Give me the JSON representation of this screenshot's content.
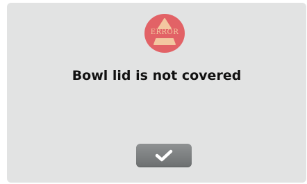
{
  "dialog": {
    "badge": {
      "icon": "error-warning-icon",
      "text": "ERROR",
      "color": "#e26266",
      "text_color": "#f3c7a0"
    },
    "message": "Bowl lid is not covered",
    "confirm_button": {
      "icon": "checkmark-icon",
      "color": "#7e8182"
    },
    "background": "#e2e3e3"
  }
}
